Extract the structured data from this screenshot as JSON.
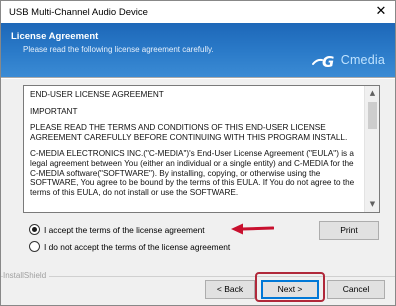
{
  "window": {
    "title": "USB Multi-Channel Audio Device",
    "close_glyph": "✕"
  },
  "banner": {
    "heading": "License Agreement",
    "subtitle": "Please read the following license agreement carefully.",
    "brand": "Cmedia",
    "brand_icon": "cmedia-g-logo",
    "colors": {
      "banner_top": "#1d67b8",
      "banner_bottom": "#3b8bd4",
      "brand_text": "#bfe3ff"
    }
  },
  "license_text": {
    "paragraphs": [
      "END-USER LICENSE AGREEMENT",
      "IMPORTANT",
      "PLEASE READ THE TERMS AND CONDITIONS OF THIS END-USER LICENSE AGREEMENT CAREFULLY BEFORE CONTINUING WITH THIS PROGRAM INSTALL.",
      "C-MEDIA ELECTRONICS INC.(\"C-MEDIA\")'s End-User License Agreement (\"EULA\") is a legal agreement between You (either an individual or a single entity) and C-MEDIA for the C-MEDIA software(\"SOFTWARE\"). By installing, copying, or otherwise using the SOFTWARE, You agree to be bound by the terms of this EULA. If You do not agree to the terms of this EULA, do not install or use the SOFTWARE."
    ],
    "scroll_up_icon": "▲",
    "scroll_down_icon": "▼"
  },
  "options": {
    "accept_label": "I accept the terms of the license agreement",
    "decline_label": "I do not accept the terms of the license agreement",
    "selected": "accept"
  },
  "buttons": {
    "print": "Print",
    "back": "< Back",
    "next": "Next >",
    "cancel": "Cancel"
  },
  "footer": {
    "installshield": "InstallShield"
  },
  "annotations": {
    "arrow_color": "#c8102e",
    "highlight_color": "#b0283a"
  }
}
